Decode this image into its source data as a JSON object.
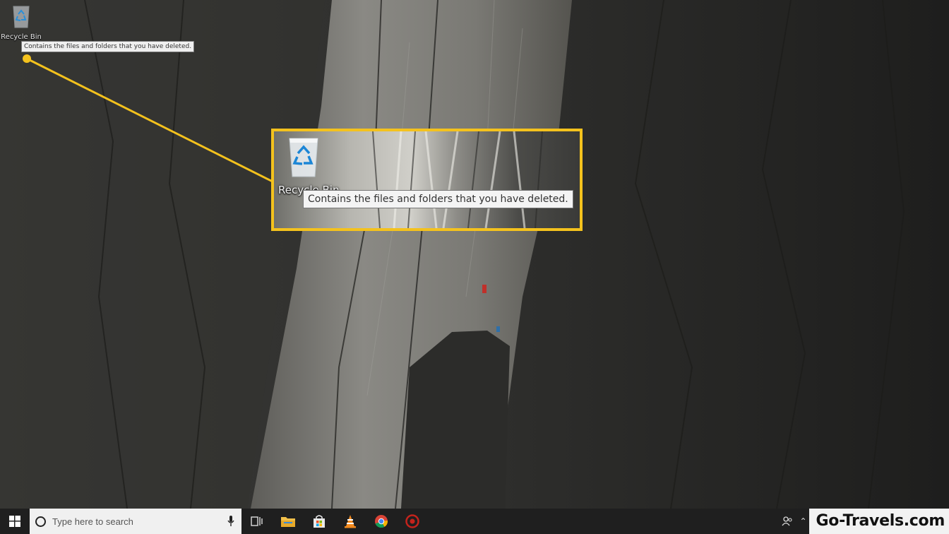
{
  "desktop": {
    "recycle_bin": {
      "label": "Recycle Bin",
      "icon": "recycle-bin-icon",
      "tooltip": "Contains the files and folders that you have deleted."
    }
  },
  "callout": {
    "color": "#f4c21d",
    "zoom_label": "Recycle Bin",
    "zoom_tooltip": "Contains the files and folders that you have deleted."
  },
  "taskbar": {
    "start_icon": "windows-logo-icon",
    "search_placeholder": "Type here to search",
    "search_icon": "cortana-circle-icon",
    "mic_icon": "microphone-icon",
    "items": [
      {
        "name": "task-view",
        "icon": "task-view-icon"
      },
      {
        "name": "file-explorer",
        "icon": "folder-icon"
      },
      {
        "name": "store",
        "icon": "store-bag-icon"
      },
      {
        "name": "vlc",
        "icon": "vlc-cone-icon"
      },
      {
        "name": "chrome",
        "icon": "chrome-icon"
      },
      {
        "name": "app-red",
        "icon": "red-circle-app-icon"
      }
    ],
    "tray": {
      "people_icon": "people-icon",
      "chevron_icon": "show-hidden-icons-chevron"
    }
  },
  "watermark": {
    "text": "Go-Travels.com"
  }
}
